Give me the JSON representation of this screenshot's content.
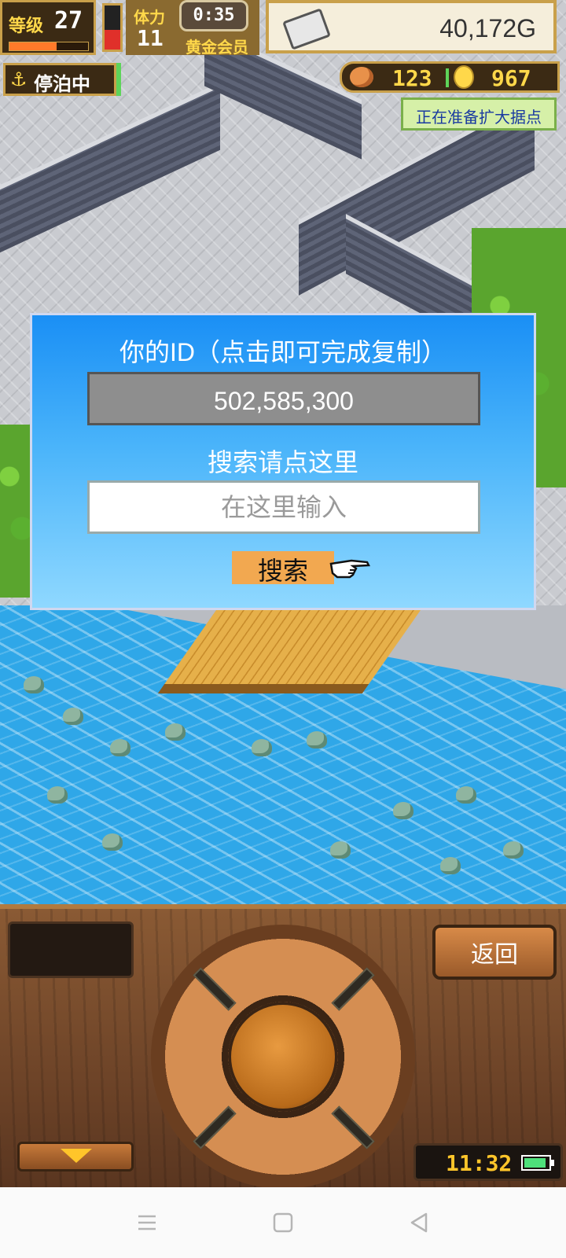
{
  "hud": {
    "level_label": "等级",
    "level_value": "27",
    "level_progress": 0.6,
    "stamina_label": "体力",
    "stamina_value": "11",
    "stamina_level": 0.45,
    "timer": "0:35",
    "gold_member": "黄金会员",
    "money": "40,172G",
    "docked_status": "停泊中",
    "food_count": "123",
    "coin_count": "967",
    "expand_notice": "正在准备扩大据点"
  },
  "dialog": {
    "title": "你的ID（点击即可完成复制）",
    "id_value": "502,585,300",
    "search_label": "搜索请点这里",
    "search_placeholder": "在这里输入",
    "search_button": "搜索"
  },
  "panel": {
    "back_label": "返回",
    "clock": "11:32",
    "battery_level": 0.9
  },
  "colors": {
    "dialog_top": "#1a8ff5",
    "dialog_bottom": "#8fd8ff",
    "water": "#2fa7e8",
    "search_button": "#f2a850"
  },
  "icons": [
    "anchor-icon",
    "meat-icon",
    "coin-icon",
    "silver-bar-icon",
    "pointing-hand-icon",
    "dropdown-arrow-icon",
    "battery-icon",
    "menu-icon",
    "home-icon",
    "back-triangle-icon"
  ]
}
